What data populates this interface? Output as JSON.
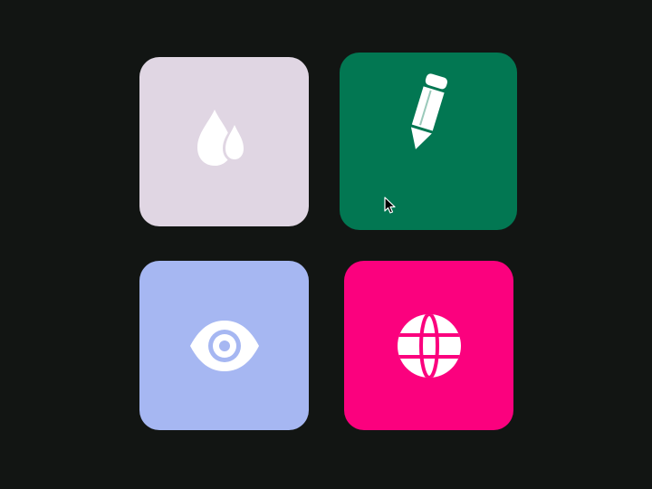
{
  "tiles": [
    {
      "id": "drops",
      "icon": "water-drops-icon",
      "color": "#e0d6e3",
      "icon_color": "#ffffff"
    },
    {
      "id": "pencil",
      "icon": "pencil-icon",
      "color": "#027752",
      "icon_color": "#ffffff"
    },
    {
      "id": "eye",
      "icon": "eye-icon",
      "color": "#a6b7f2",
      "icon_color": "#ffffff"
    },
    {
      "id": "globe",
      "icon": "globe-icon",
      "color": "#fb017e",
      "icon_color": "#ffffff"
    }
  ],
  "background": "#121513",
  "cursor": {
    "icon": "mouse-pointer-icon"
  }
}
